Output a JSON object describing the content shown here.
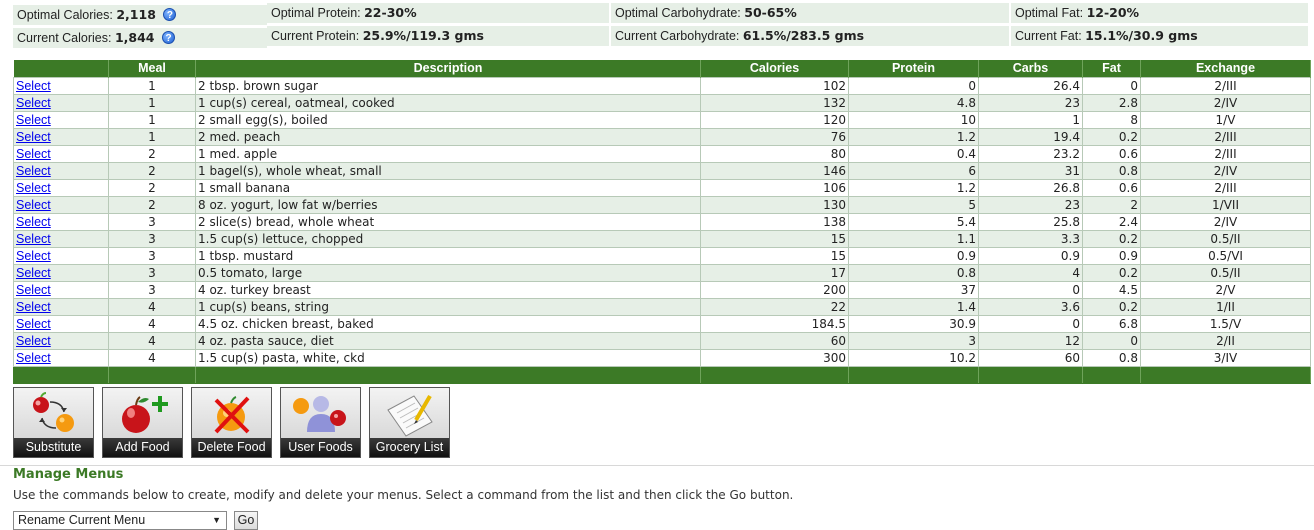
{
  "summary": {
    "optimal_calories_label": "Optimal Calories:",
    "optimal_calories_value": "2,118",
    "current_calories_label": "Current Calories:",
    "current_calories_value": "1,844",
    "optimal_protein_label": "Optimal Protein:",
    "optimal_protein_value": "22-30%",
    "current_protein_label": "Current Protein:",
    "current_protein_value": "25.9%/119.3 gms",
    "optimal_carb_label": "Optimal Carbohydrate:",
    "optimal_carb_value": "50-65%",
    "current_carb_label": "Current Carbohydrate:",
    "current_carb_value": "61.5%/283.5 gms",
    "optimal_fat_label": "Optimal Fat:",
    "optimal_fat_value": "12-20%",
    "current_fat_label": "Current Fat:",
    "current_fat_value": "15.1%/30.9 gms",
    "help_glyph": "?"
  },
  "table": {
    "headers": [
      "",
      "Meal",
      "Description",
      "Calories",
      "Protein",
      "Carbs",
      "Fat",
      "Exchange"
    ],
    "select_label": "Select",
    "rows": [
      {
        "meal": "1",
        "description": "2 tbsp. brown sugar",
        "calories": "102",
        "protein": "0",
        "carbs": "26.4",
        "fat": "0",
        "exchange": "2/III"
      },
      {
        "meal": "1",
        "description": "1 cup(s) cereal, oatmeal, cooked",
        "calories": "132",
        "protein": "4.8",
        "carbs": "23",
        "fat": "2.8",
        "exchange": "2/IV"
      },
      {
        "meal": "1",
        "description": "2 small egg(s), boiled",
        "calories": "120",
        "protein": "10",
        "carbs": "1",
        "fat": "8",
        "exchange": "1/V"
      },
      {
        "meal": "1",
        "description": "2 med. peach",
        "calories": "76",
        "protein": "1.2",
        "carbs": "19.4",
        "fat": "0.2",
        "exchange": "2/III"
      },
      {
        "meal": "2",
        "description": "1 med. apple",
        "calories": "80",
        "protein": "0.4",
        "carbs": "23.2",
        "fat": "0.6",
        "exchange": "2/III"
      },
      {
        "meal": "2",
        "description": "1 bagel(s), whole wheat, small",
        "calories": "146",
        "protein": "6",
        "carbs": "31",
        "fat": "0.8",
        "exchange": "2/IV"
      },
      {
        "meal": "2",
        "description": "1 small banana",
        "calories": "106",
        "protein": "1.2",
        "carbs": "26.8",
        "fat": "0.6",
        "exchange": "2/III"
      },
      {
        "meal": "2",
        "description": "8 oz. yogurt, low fat w/berries",
        "calories": "130",
        "protein": "5",
        "carbs": "23",
        "fat": "2",
        "exchange": "1/VII"
      },
      {
        "meal": "3",
        "description": "2 slice(s) bread, whole wheat",
        "calories": "138",
        "protein": "5.4",
        "carbs": "25.8",
        "fat": "2.4",
        "exchange": "2/IV"
      },
      {
        "meal": "3",
        "description": "1.5 cup(s) lettuce, chopped",
        "calories": "15",
        "protein": "1.1",
        "carbs": "3.3",
        "fat": "0.2",
        "exchange": "0.5/II"
      },
      {
        "meal": "3",
        "description": "1 tbsp. mustard",
        "calories": "15",
        "protein": "0.9",
        "carbs": "0.9",
        "fat": "0.9",
        "exchange": "0.5/VI"
      },
      {
        "meal": "3",
        "description": "0.5 tomato, large",
        "calories": "17",
        "protein": "0.8",
        "carbs": "4",
        "fat": "0.2",
        "exchange": "0.5/II"
      },
      {
        "meal": "3",
        "description": "4 oz. turkey breast",
        "calories": "200",
        "protein": "37",
        "carbs": "0",
        "fat": "4.5",
        "exchange": "2/V"
      },
      {
        "meal": "4",
        "description": "1 cup(s) beans, string",
        "calories": "22",
        "protein": "1.4",
        "carbs": "3.6",
        "fat": "0.2",
        "exchange": "1/II"
      },
      {
        "meal": "4",
        "description": "4.5 oz. chicken breast, baked",
        "calories": "184.5",
        "protein": "30.9",
        "carbs": "0",
        "fat": "6.8",
        "exchange": "1.5/V"
      },
      {
        "meal": "4",
        "description": "4 oz. pasta sauce, diet",
        "calories": "60",
        "protein": "3",
        "carbs": "12",
        "fat": "0",
        "exchange": "2/II"
      },
      {
        "meal": "4",
        "description": "1.5 cup(s) pasta, white, ckd",
        "calories": "300",
        "protein": "10.2",
        "carbs": "60",
        "fat": "0.8",
        "exchange": "3/IV"
      }
    ]
  },
  "toolbar": {
    "substitute_label": "Substitute",
    "add_food_label": "Add Food",
    "delete_food_label": "Delete Food",
    "user_foods_label": "User Foods",
    "grocery_list_label": "Grocery List"
  },
  "manage_menus": {
    "title": "Manage Menus",
    "description": "Use the commands below to create, modify and delete your menus. Select a command from the list and then click the Go button.",
    "selected_command": "Rename Current Menu",
    "go_label": "Go"
  },
  "colors": {
    "header_green": "#3c7a26",
    "row_tint": "#e6efe6",
    "link_blue": "#0000ee"
  }
}
